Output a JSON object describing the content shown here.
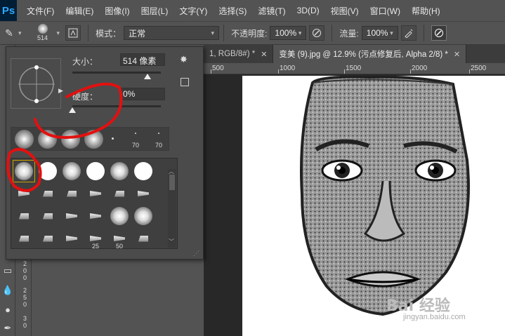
{
  "app": {
    "logo": "Ps"
  },
  "menu": [
    "文件(F)",
    "编辑(E)",
    "图像(I)",
    "图层(L)",
    "文字(Y)",
    "选择(S)",
    "滤镜(T)",
    "3D(D)",
    "视图(V)",
    "窗口(W)",
    "帮助(H)"
  ],
  "options": {
    "brush_size": "514",
    "mode_label": "模式：",
    "mode_value": "正常",
    "opacity_label": "不透明度:",
    "opacity_value": "100%",
    "flow_label": "流量:",
    "flow_value": "100%"
  },
  "tabs": [
    {
      "label": "1, RGB/8#) *",
      "active": false
    },
    {
      "label": "变美 (9).jpg @ 12.9% (污点修复后, Alpha 2/8) *",
      "active": true
    }
  ],
  "ruler": {
    "h_labels": [
      "500",
      "1000",
      "1500",
      "2000",
      "2500"
    ]
  },
  "brush_panel": {
    "size_label": "大小：",
    "size_value": "514 像素",
    "size_slider_value": 0.85,
    "hardness_label": "硬度：",
    "hardness_value": "0%",
    "hardness_slider_value": 0.0,
    "recent_labels": [
      "70",
      "70"
    ],
    "grid_labels": [
      "25",
      "50"
    ]
  },
  "watermark": {
    "main": "Bai 经验",
    "sub": "jingyan.baidu.com"
  }
}
